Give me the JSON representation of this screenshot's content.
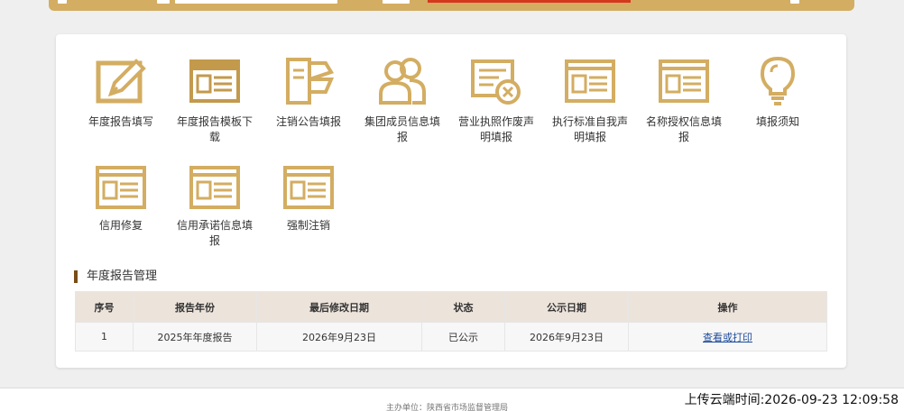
{
  "colors": {
    "gold": "#d3ad62",
    "brown": "#7a4d16",
    "link": "#1d4b9a"
  },
  "tiles": [
    {
      "icon": "edit-form-icon",
      "label": "年度报告填写"
    },
    {
      "icon": "template-download-icon",
      "label": "年度报告模板下载"
    },
    {
      "icon": "cancel-notice-icon",
      "label": "注销公告填报"
    },
    {
      "icon": "group-members-icon",
      "label": "集团成员信息填报"
    },
    {
      "icon": "license-void-icon",
      "label": "营业执照作废声明填报"
    },
    {
      "icon": "standard-declaration-icon",
      "label": "执行标准自我声明填报"
    },
    {
      "icon": "name-authorization-icon",
      "label": "名称授权信息填报"
    },
    {
      "icon": "lightbulb-icon",
      "label": "填报须知"
    },
    {
      "icon": "credit-repair-icon",
      "label": "信用修复"
    },
    {
      "icon": "credit-commitment-icon",
      "label": "信用承诺信息填报"
    },
    {
      "icon": "forced-cancel-icon",
      "label": "强制注销"
    }
  ],
  "section": {
    "title": "年度报告管理"
  },
  "table": {
    "headers": [
      "序号",
      "报告年份",
      "最后修改日期",
      "状态",
      "公示日期",
      "操作"
    ],
    "rows": [
      {
        "index": "1",
        "year": "2025年年度报告",
        "modified": "2026年9月23日",
        "status": "已公示",
        "published": "2026年9月23日",
        "action": "查看或打印"
      }
    ]
  },
  "footer": {
    "org": "主办单位：陕西省市场监督管理局"
  },
  "upload_time": "上传云端时间:2026-09-23 12:09:58"
}
